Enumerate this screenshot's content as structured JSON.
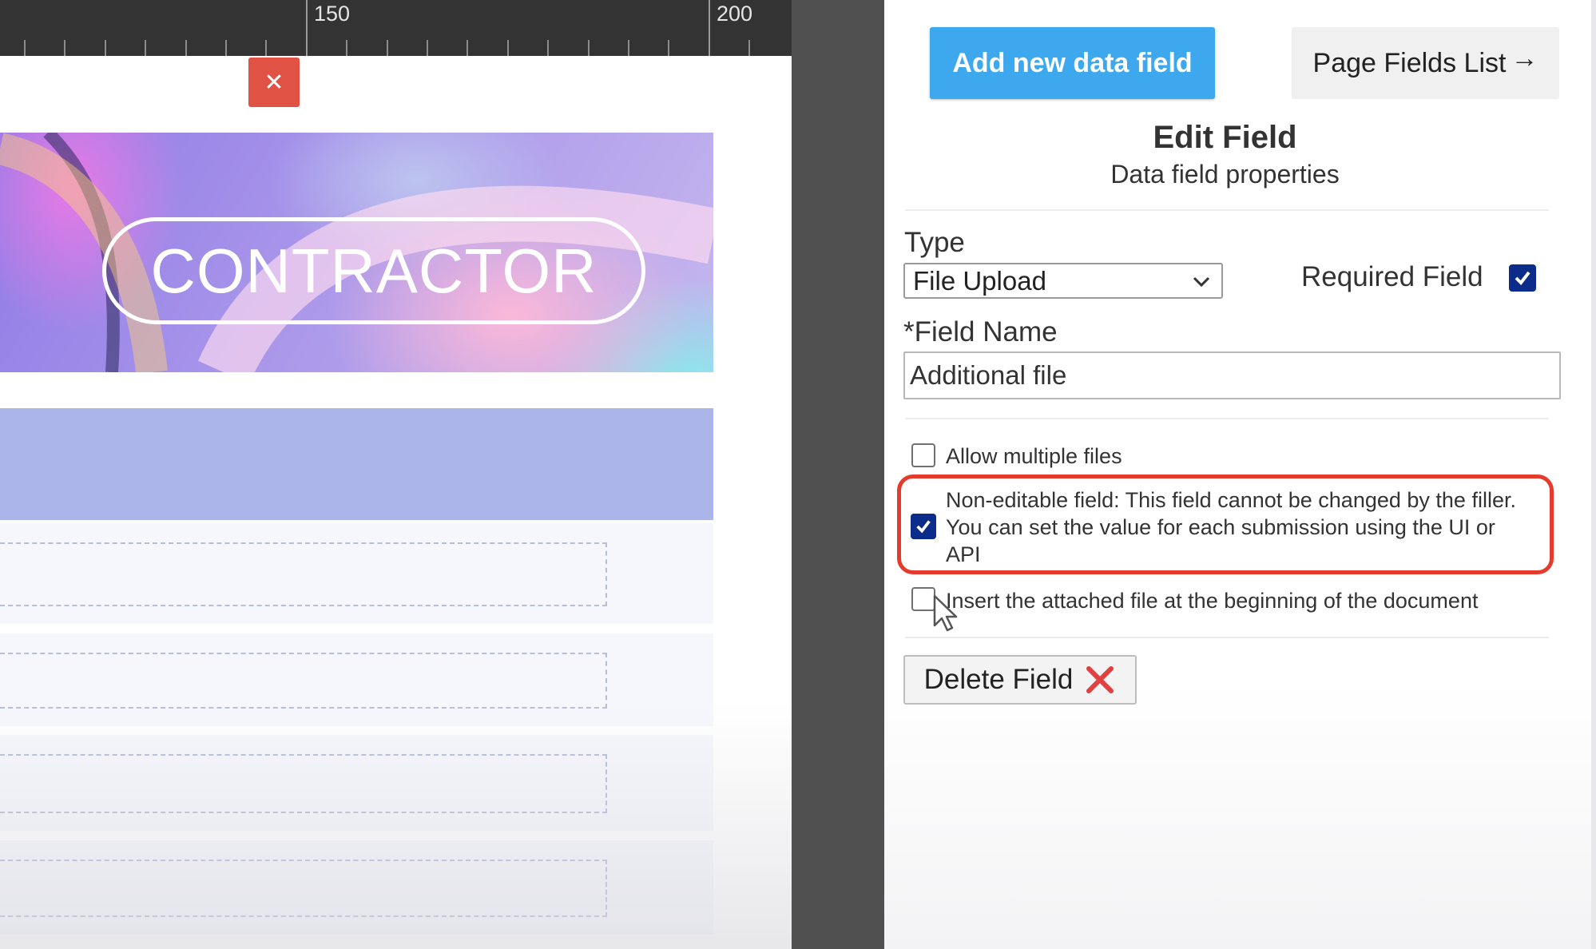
{
  "ruler": {
    "labels": [
      "150",
      "200"
    ]
  },
  "editor": {
    "close_symbol": "✕",
    "banner_text": "CONTRACTOR"
  },
  "panel": {
    "add_field_label": "Add new data field",
    "fields_list_label": "Page Fields List",
    "fields_list_arrow": "→",
    "title": "Edit Field",
    "subtitle": "Data field properties",
    "type": {
      "label": "Type",
      "selected": "File Upload"
    },
    "required": {
      "label": "Required Field",
      "checked": true
    },
    "field_name": {
      "label": "*Field Name",
      "value": "Additional file"
    },
    "options": [
      {
        "label": "Allow multiple files",
        "checked": false
      },
      {
        "label": "Non-editable field: This field cannot be changed by the filler. You can set the value for each submission using the UI or API",
        "checked": true
      },
      {
        "label": "Insert the attached file at the beginning of the document",
        "checked": false
      }
    ],
    "delete_label": "Delete Field"
  },
  "colors": {
    "accent_blue": "#3ea8ee",
    "checkbox_navy": "#0b2c8a",
    "highlight_red": "#e53b2c",
    "delete_red": "#e0403f"
  },
  "icons": [
    "close-icon",
    "arrow-right-icon",
    "chevron-down-icon",
    "checkmark-icon",
    "delete-x-icon",
    "mouse-cursor-icon"
  ]
}
